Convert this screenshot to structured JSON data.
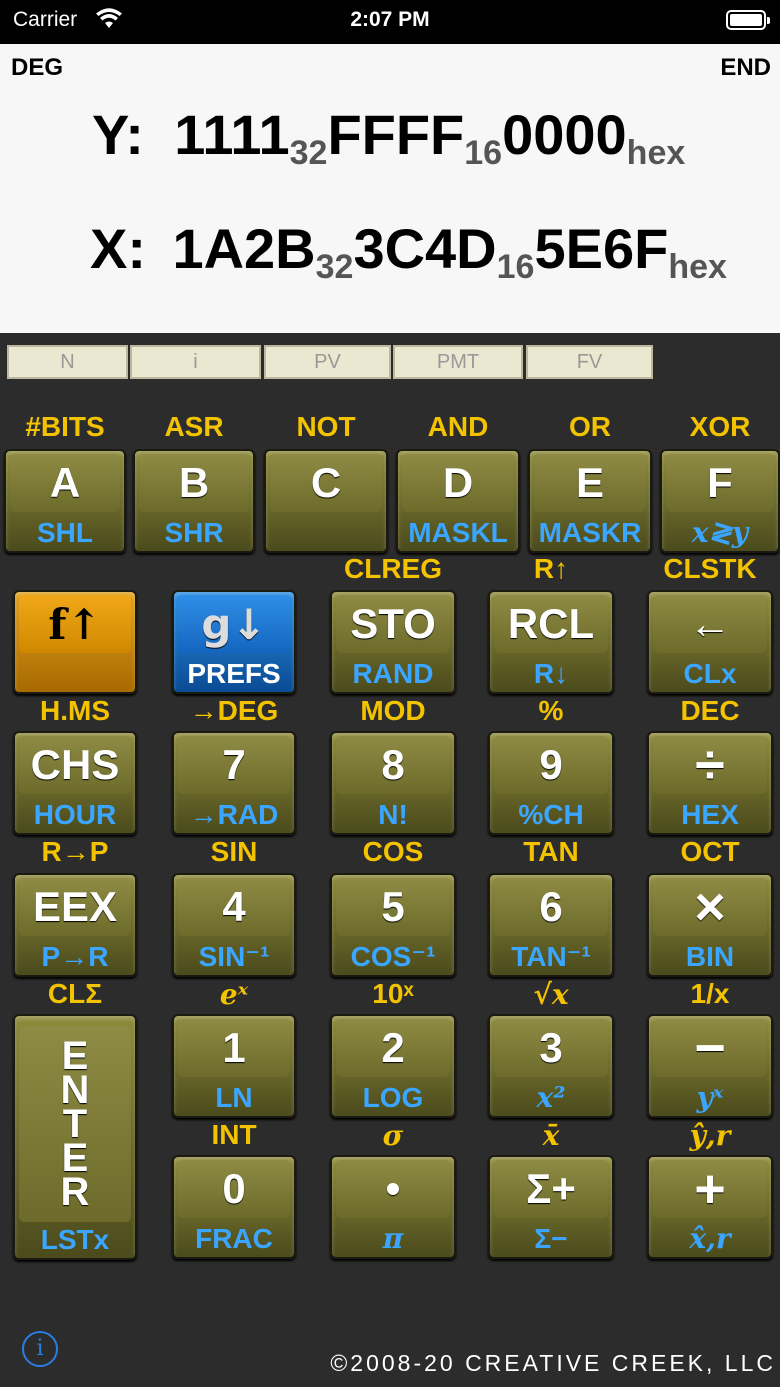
{
  "status": {
    "carrier": "Carrier",
    "time": "2:07 PM"
  },
  "display": {
    "deg": "DEG",
    "end": "END",
    "y_label": "Y:",
    "y_part1": "1111",
    "y_sub1": "32",
    "y_part2": "FFFF",
    "y_sub2": "16",
    "y_part3": "0000",
    "y_suffix": "hex",
    "x_label": "X:",
    "x_part1": "1A2B",
    "x_sub1": "32",
    "x_part2": "3C4D",
    "x_sub2": "16",
    "x_part3": "5E6F",
    "x_suffix": "hex"
  },
  "fin": [
    "N",
    "i",
    "PV",
    "PMT",
    "FV"
  ],
  "row1": [
    {
      "top": "#BITS",
      "face": "A",
      "low": "SHL"
    },
    {
      "top": "ASR",
      "face": "B",
      "low": "SHR"
    },
    {
      "top": "NOT",
      "face": "C",
      "low": ""
    },
    {
      "top": "AND",
      "face": "D",
      "low": "MASKL"
    },
    {
      "top": "OR",
      "face": "E",
      "low": "MASKR"
    },
    {
      "top": "XOR",
      "face": "F",
      "low": "x≷y"
    }
  ],
  "row2": [
    {
      "top": "",
      "face": "f↑",
      "low": ""
    },
    {
      "top": "",
      "face": "g↓",
      "low": "PREFS"
    },
    {
      "top": "CLREG",
      "face": "STO",
      "low": "RAND"
    },
    {
      "top": "R↑",
      "face": "RCL",
      "low": "R↓"
    },
    {
      "top": "CLSTK",
      "face": "←",
      "low": "CLx"
    }
  ],
  "row3": [
    {
      "top": "H.MS",
      "face": "CHS",
      "low": "HOUR"
    },
    {
      "top": "→DEG",
      "face": "7",
      "low": "→RAD"
    },
    {
      "top": "MOD",
      "face": "8",
      "low": "N!"
    },
    {
      "top": "%",
      "face": "9",
      "low": "%CH"
    },
    {
      "top": "DEC",
      "face": "÷",
      "low": "HEX"
    }
  ],
  "row4": [
    {
      "top": "R→P",
      "face": "EEX",
      "low": "P→R"
    },
    {
      "top": "SIN",
      "face": "4",
      "low": "SIN⁻¹"
    },
    {
      "top": "COS",
      "face": "5",
      "low": "COS⁻¹"
    },
    {
      "top": "TAN",
      "face": "6",
      "low": "TAN⁻¹"
    },
    {
      "top": "OCT",
      "face": "×",
      "low": "BIN"
    }
  ],
  "row5": [
    {
      "top": "CLΣ",
      "face": "",
      "low": ""
    },
    {
      "top": "eˣ",
      "face": "1",
      "low": "LN"
    },
    {
      "top": "10ˣ",
      "face": "2",
      "low": "LOG"
    },
    {
      "top": "√x",
      "face": "3",
      "low": "x²"
    },
    {
      "top": "1/x",
      "face": "−",
      "low": "yˣ"
    }
  ],
  "row6": [
    {
      "top": "INT",
      "face": "0",
      "low": "FRAC"
    },
    {
      "top": "σ",
      "face": "•",
      "low": "π"
    },
    {
      "top": "x̄",
      "face": "Σ+",
      "low": "Σ−"
    },
    {
      "top": "ŷ,r",
      "face": "+",
      "low": "x̂,r"
    }
  ],
  "enter": {
    "letters": [
      "E",
      "N",
      "T",
      "E",
      "R"
    ],
    "low": "LSTx"
  },
  "footer": {
    "info": "i",
    "copyright": "©2008-20 CREATIVE CREEK, LLC"
  }
}
